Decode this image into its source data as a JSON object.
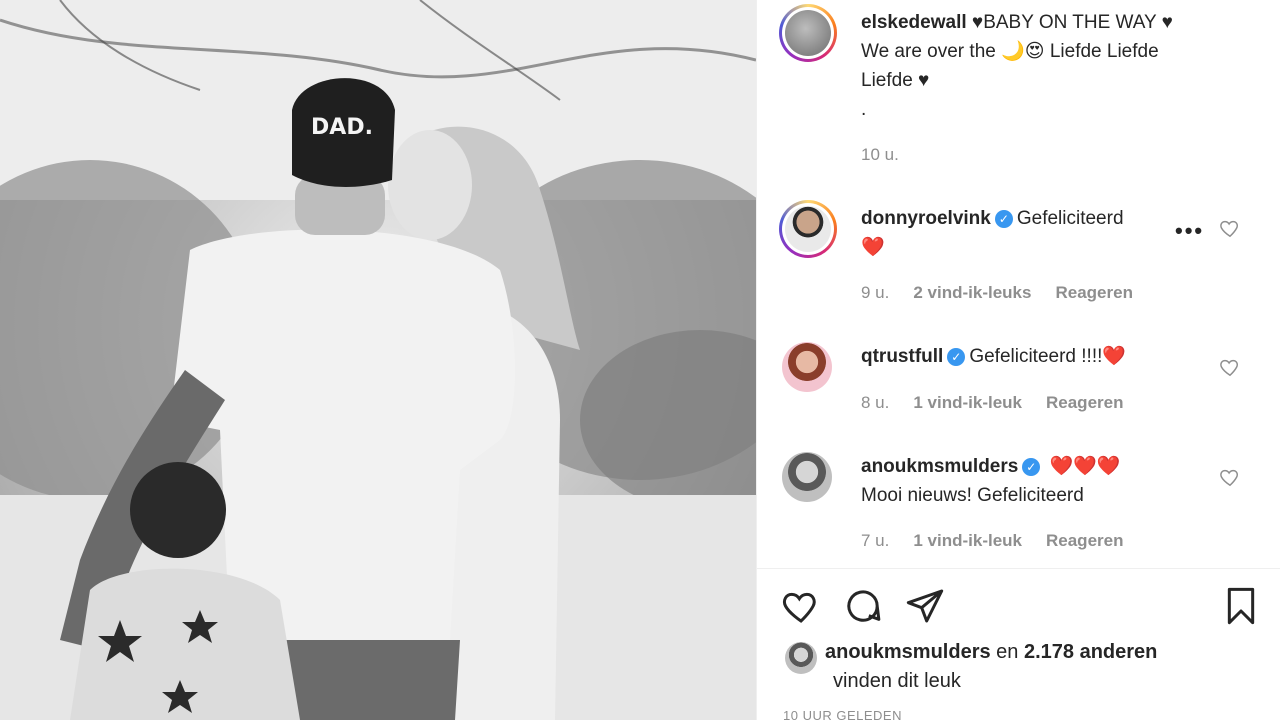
{
  "post": {
    "author": "elskedewall",
    "caption": "♥BABY ON THE WAY ♥ We are over the 🌙😍 Liefde Liefde Liefde ♥",
    "caption_line1": "♥BABY ON THE WAY ♥",
    "caption_line2": "We are over the 🌙😍 Liefde Liefde",
    "caption_line3": "Liefde ♥",
    "caption_dot": ".",
    "time": "10 u.",
    "photo_cap_text": "DAD."
  },
  "comments": [
    {
      "user": "donnyroelvink",
      "text": "Gefeliciteerd",
      "text_line2": "❤️",
      "time": "9 u.",
      "likes": "2 vind-ik-leuks",
      "reply": "Reageren"
    },
    {
      "user": "qtrustfull",
      "text": "Gefeliciteerd !!!!❤️",
      "time": "8 u.",
      "likes": "1 vind-ik-leuk",
      "reply": "Reageren"
    },
    {
      "user": "anoukmsmulders",
      "text": "❤️❤️❤️",
      "text_line2": "Mooi nieuws! Gefeliciteerd",
      "time": "7 u.",
      "likes": "1 vind-ik-leuk",
      "reply": "Reageren"
    }
  ],
  "likes": {
    "liker": "anoukmsmulders",
    "connector": "en",
    "others": "2.178 anderen",
    "suffix": "vinden dit leuk"
  },
  "footer_time": "10 UUR GELEDEN",
  "more_label": "•••",
  "verified_glyph": "✓",
  "colors": {
    "accent_red": "#ed4956",
    "verified_blue": "#3897f0",
    "muted": "#8e8e8e"
  },
  "icons": [
    "heart-icon",
    "comment-icon",
    "share-icon",
    "bookmark-icon"
  ]
}
